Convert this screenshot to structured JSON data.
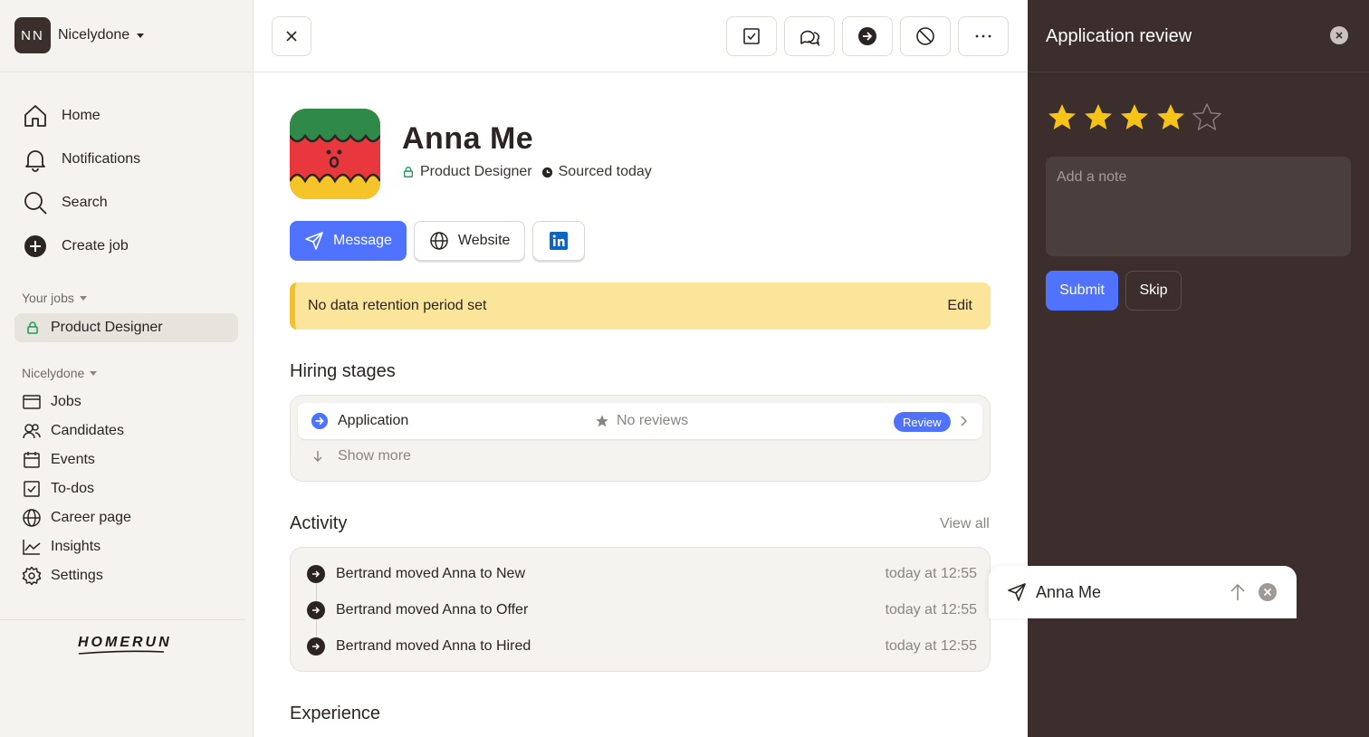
{
  "org": {
    "initials": "NN",
    "name": "Nicelydone"
  },
  "nav_main": [
    {
      "label": "Home",
      "icon": "home-icon"
    },
    {
      "label": "Notifications",
      "icon": "bell-icon"
    },
    {
      "label": "Search",
      "icon": "search-icon"
    },
    {
      "label": "Create job",
      "icon": "plus-circle-icon"
    }
  ],
  "your_jobs": {
    "label": "Your jobs",
    "items": [
      {
        "label": "Product Designer",
        "icon": "lock-icon"
      }
    ]
  },
  "org_section": {
    "label": "Nicelydone",
    "items": [
      {
        "label": "Jobs",
        "icon": "briefcase-icon"
      },
      {
        "label": "Candidates",
        "icon": "users-icon"
      },
      {
        "label": "Events",
        "icon": "calendar-icon"
      },
      {
        "label": "To-dos",
        "icon": "checkbox-icon"
      },
      {
        "label": "Career page",
        "icon": "globe-icon"
      },
      {
        "label": "Insights",
        "icon": "chart-icon"
      },
      {
        "label": "Settings",
        "icon": "gear-icon"
      }
    ]
  },
  "brand": {
    "logo_text": "HOMERUN"
  },
  "toolbar": {
    "close": "close-icon",
    "icons": [
      "checkbox-icon",
      "chat-icon",
      "arrow-right-circle-icon",
      "block-icon",
      "more-icon"
    ]
  },
  "candidate": {
    "name": "Anna Me",
    "job": "Product Designer",
    "sourced": "Sourced today",
    "message_label": "Message",
    "website_label": "Website"
  },
  "banner": {
    "text": "No data retention period set",
    "action": "Edit"
  },
  "hiring": {
    "title": "Hiring stages",
    "stage": {
      "label": "Application",
      "reviews": "No reviews",
      "badge": "Review"
    },
    "show_more": "Show more"
  },
  "activity": {
    "title": "Activity",
    "view_all": "View all",
    "items": [
      {
        "text": "Bertrand moved Anna to New",
        "time": "today at 12:55"
      },
      {
        "text": "Bertrand moved Anna to Offer",
        "time": "today at 12:55"
      },
      {
        "text": "Bertrand moved Anna to Hired",
        "time": "today at 12:55"
      }
    ]
  },
  "experience": {
    "title": "Experience"
  },
  "review": {
    "title": "Application review",
    "rating": 4,
    "max_rating": 5,
    "note_placeholder": "Add a note",
    "submit": "Submit",
    "skip": "Skip"
  },
  "floating_message": {
    "name": "Anna Me"
  },
  "colors": {
    "accent": "#4f73ff",
    "banner": "#fbe59a",
    "panel_dark": "#3b2e2c",
    "star": "#f6c417"
  }
}
